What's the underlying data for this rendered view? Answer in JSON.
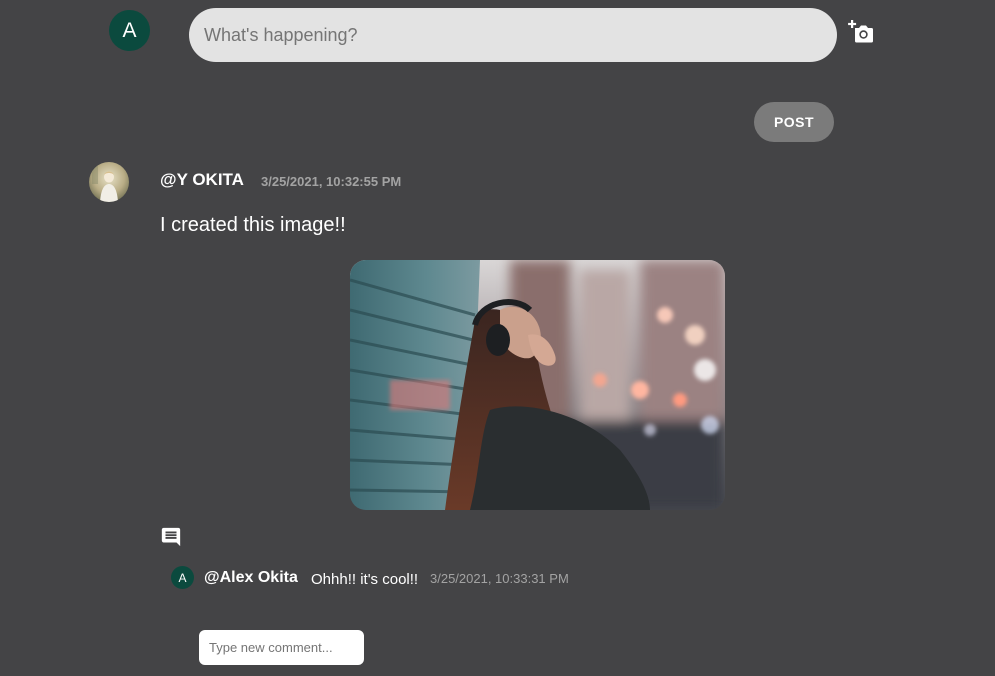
{
  "composer": {
    "avatar_letter": "A",
    "placeholder": "What's happening?",
    "add_photo_icon": "add-a-photo-icon",
    "post_label": "POST"
  },
  "post": {
    "username": "@Y OKITA",
    "timestamp": "3/25/2021, 10:32:55 PM",
    "text": "I created this image!!",
    "comment_icon": "comment-icon",
    "comments": [
      {
        "avatar_letter": "A",
        "username": "@Alex Okita",
        "text": "Ohhh!! it's cool!!",
        "timestamp": "3/25/2021, 10:33:31 PM"
      }
    ],
    "new_comment_placeholder": "Type new comment..."
  },
  "colors": {
    "background": "#444446",
    "avatar_green": "#0b4a3e",
    "post_button": "#7b7b7b",
    "input_bg": "#e3e3e3",
    "muted_text": "#a3a3a3"
  }
}
